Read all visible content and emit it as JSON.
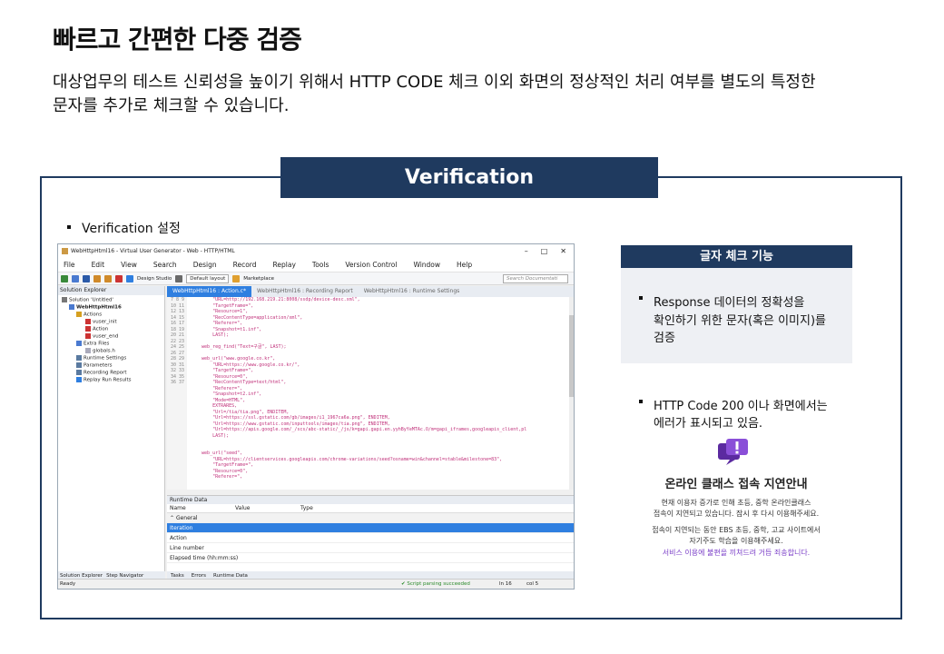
{
  "heading": {
    "title": "빠르고 간편한 다중 검증",
    "desc_line1": "대상업무의 테스트 신뢰성을 높이기 위해서 HTTP CODE 체크 이외 화면의 정상적인 처리 여부를 별도의 특정한",
    "desc_line2": "문자를 추가로 체크할 수 있습니다."
  },
  "panel": {
    "tab_label": "Verification",
    "bullet_label": "Verification 설정"
  },
  "app": {
    "title": "WebHttpHtml16 - Virtual User Generator - Web - HTTP/HTML",
    "menu": [
      "File",
      "Edit",
      "View",
      "Search",
      "Design",
      "Record",
      "Replay",
      "Tools",
      "Version Control",
      "Window",
      "Help"
    ],
    "toolbar": {
      "design_studio": "Design Studio",
      "layout": "Default layout",
      "marketplace": "Marketplace",
      "search_placeholder": "Search Documentati"
    },
    "explorer": {
      "header": "Solution Explorer",
      "items": [
        "Solution 'Untitled'",
        "WebHttpHtml16",
        "Actions",
        "vuser_init",
        "Action",
        "vuser_end",
        "Extra Files",
        "globals.h",
        "Runtime Settings",
        "Parameters",
        "Recording Report",
        "Replay Run Results"
      ],
      "tab1": "Solution Explorer",
      "tab2": "Step Navigator"
    },
    "editor": {
      "tabs": [
        "WebHttpHtml16 : Action.c*",
        "WebHttpHtml16 : Recording Report",
        "WebHttpHtml16 : Runtime Settings"
      ],
      "line_numbers": "7\n8\n9\n10\n11\n12\n13\n14\n15\n16\n17\n18\n19\n20\n21\n22\n23\n24\n25\n26\n27\n28\n29\n30\n31\n32\n33\n34\n35\n36\n37",
      "code": "        \"URL=http://192.168.219.21:8008/ssdp/device-desc.xml\",\n        \"TargetFrame=\",\n        \"Resource=1\",\n        \"RecContentType=application/xml\",\n        \"Referer=\",\n        \"Snapshot=t1.inf\",\n        LAST);\n\n    web_reg_find(\"Text=구글\", LAST);\n\n    web_url(\"www.google.co.kr\",\n        \"URL=https://www.google.co.kr/\",\n        \"TargetFrame=\",\n        \"Resource=0\",\n        \"RecContentType=text/html\",\n        \"Referer=\",\n        \"Snapshot=t2.inf\",\n        \"Mode=HTML\",\n        EXTRARES,\n        \"Url=/tia/tia.png\", ENDITEM,\n        \"Url=https://ssl.gstatic.com/gb/images/i1_1967ca6a.png\", ENDITEM,\n        \"Url=https://www.gstatic.com/inputtools/images/tia.png\", ENDITEM,\n        \"Url=https://apis.google.com/_/scs/abc-static/_/js/k=gapi.gapi.en.yyhByYeMTAc.O/m=gapi_iframes,googleapis_client,pl\n        LAST);\n\n\n    web_url(\"seed\",\n        \"URL=https://clientservices.googleapis.com/chrome-variations/seed?osname=win&channel=stable&milestone=83\",\n        \"TargetFrame=\",\n        \"Resource=0\",\n        \"Referer=\","
    },
    "runtime": {
      "header": "Runtime Data",
      "col_name": "Name",
      "col_value": "Value",
      "col_type": "Type",
      "group": "General",
      "rows": [
        "Iteration",
        "Action",
        "Line number",
        "Elapsed time (hh:mm:ss)"
      ],
      "tabs": [
        "Tasks",
        "Errors",
        "Runtime Data"
      ]
    },
    "status": {
      "ready": "Ready",
      "parse": "Script parsing succeeded",
      "line": "ln 16",
      "col": "col 5"
    }
  },
  "feature": {
    "title": "글자 체크 기능",
    "bullet1_line1": "Response 데이터의 정확성을",
    "bullet1_line2": "확인하기 위한 문자(혹은 이미지)를",
    "bullet1_line3": "검증",
    "bullet2_line1": "HTTP Code 200 이나 화면에서는",
    "bullet2_line2": "에러가 표시되고 있음."
  },
  "notice": {
    "title": "온라인 클래스 접속 지연안내",
    "line1": "현재 이용자 증가로 인해 초등, 중학 온라인클래스",
    "line2": "접속이 지연되고 있습니다. 잠시 후 다시 이용해주세요.",
    "line3": "접속이 지연되는 동안 EBS 초등, 중학, 고교 사이트에서",
    "line4": "자기주도 학습을 이용해주세요.",
    "line5": "서비스 이용에 불편을 끼쳐드려 거듭 죄송합니다.",
    "accent_color": "#7b3fc8"
  }
}
